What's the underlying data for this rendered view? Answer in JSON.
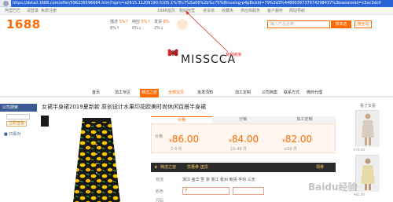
{
  "browser": {
    "url": "https://detail.1688.com/offer/596236596684.html?spm=a2615.11209190.0105.1%7Ec7%5a06%2b%c7S%8tnusing-p4p8ickId=79%3d3%4480039737974298437%3bsessionid=c5ec3dc0"
  },
  "topbar": {
    "items": [
      "阿里巴巴",
      "请登录",
      "免费注册",
      "1688首页",
      "我的阿里",
      "进货单",
      "收藏夹",
      "供应商服务",
      "客户服务",
      "网站导航"
    ]
  },
  "header": {
    "logo": "1688",
    "stats": [
      {
        "label": "描述",
        "value": "5%↑"
      },
      {
        "label": "响应",
        "value": "5%↑"
      },
      {
        "label": "发货",
        "value": "8%"
      }
    ],
    "stats_rates": [
      "8%↑",
      "0%↓",
      "2%↓"
    ],
    "search_placeholder": "输入产品名称",
    "search_btn": "搜本店",
    "search_btn2": "搜全站"
  },
  "shop": {
    "brand": "MISSCCA",
    "annotation": "复制链接"
  },
  "nav": {
    "items": [
      "首页",
      "加工专区",
      "精选之窗",
      "全部宝贝",
      "批发须知",
      "加工定制",
      "公司档案",
      "联系方式",
      "微商代理"
    ]
  },
  "sidebar": {
    "heading": "公司搜索",
    "button": "立即查看",
    "link": "■ 只看对"
  },
  "product": {
    "title": "女裙半身裙2019夏新款 原创设计水果印花欧美时尚休闲百搭半身裙",
    "tabs": [
      "价格",
      "分销",
      "加工定制"
    ],
    "prices": [
      {
        "label": "价格",
        "value": "86.00",
        "qty": "2-9 件"
      },
      {
        "label": "",
        "value": "84.00",
        "qty": "10-49 件"
      },
      {
        "label": "",
        "value": "82.00",
        "qty": "≥50 件"
      }
    ],
    "currency": "¥",
    "promo_left": "精选之窗",
    "promo_text": "优惠券  送货",
    "promo_right": "领券",
    "row1_label": "物流",
    "row1_text": "浙江 金华 至 浙 浙江 杭州 到货 平均 三天",
    "row2_label": "颜色",
    "row2_value": "7",
    "row3_label": "尺码"
  },
  "rec": {
    "heading": "看了又看",
    "captions": [
      "¥78.00",
      "¥82.00"
    ]
  },
  "watermark": "Baidu经验",
  "colors": {
    "accent": "#ff6a00",
    "nav_blue": "#3c5a93",
    "url_highlight": "#2a63d6"
  }
}
